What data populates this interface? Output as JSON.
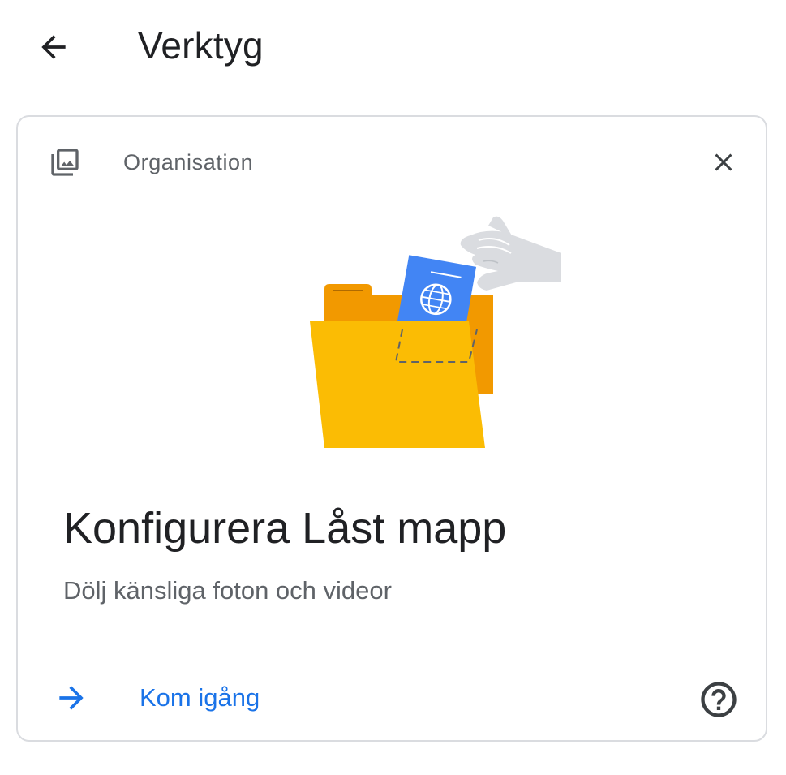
{
  "header": {
    "back_icon": "arrow-back-icon",
    "title": "Verktyg"
  },
  "card": {
    "category_icon": "photo-library-icon",
    "category": "Organisation",
    "close_icon": "close-icon",
    "illustration": "locked-folder-illustration",
    "title": "Konfigurera Låst mapp",
    "subtitle": "Dölj känsliga foton och videor",
    "action": {
      "icon": "arrow-forward-icon",
      "label": "Kom igång"
    },
    "help_icon": "help-icon"
  },
  "colors": {
    "accent": "#1a73e8",
    "text_primary": "#202124",
    "text_secondary": "#5f6368",
    "border": "#dadce0",
    "folder_front": "#fbbc04",
    "folder_back": "#f29900",
    "passport": "#4285f4",
    "hand": "#dadce0"
  }
}
